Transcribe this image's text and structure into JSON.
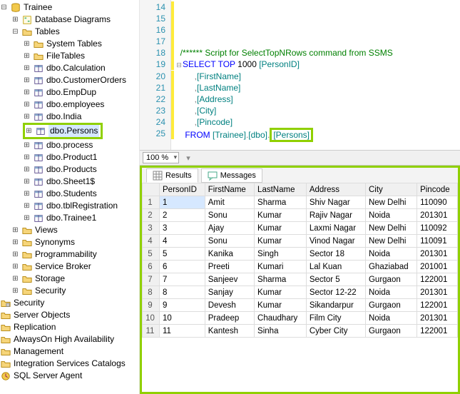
{
  "tree": {
    "trainee": "Trainee",
    "diagrams": "Database Diagrams",
    "tables": "Tables",
    "system_tables": "System Tables",
    "file_tables": "FileTables",
    "t_calc": "dbo.Calculation",
    "t_custorders": "dbo.CustomerOrders",
    "t_empdup": "dbo.EmpDup",
    "t_employees": "dbo.employees",
    "t_india": "dbo.India",
    "t_persons": "dbo.Persons",
    "t_process": "dbo.process",
    "t_product1": "dbo.Product1",
    "t_products": "dbo.Products",
    "t_sheet1": "dbo.Sheet1$",
    "t_students": "dbo.Students",
    "t_tblreg": "dbo.tblRegistration",
    "t_trainee1": "dbo.Trainee1",
    "views": "Views",
    "synonyms": "Synonyms",
    "programmability": "Programmability",
    "service_broker": "Service Broker",
    "storage": "Storage",
    "security": "Security",
    "root_security": "Security",
    "server_objects": "Server Objects",
    "replication": "Replication",
    "alwayson": "AlwaysOn High Availability",
    "management": "Management",
    "isc": "Integration Services Catalogs",
    "agent": "SQL Server Agent"
  },
  "editor": {
    "lines": {
      "l14": "14",
      "l15": "15",
      "l16": "16",
      "l17": "17",
      "l18": "18",
      "l19": "19",
      "l20": "20",
      "l21": "21",
      "l22": "22",
      "l23": "23",
      "l24": "24",
      "l25": "25"
    },
    "code": {
      "comment": "/****** Script for SelectTopNRows command from SSMS",
      "select": "SELECT",
      "top": "TOP",
      "topn": "1000",
      "personid": "[PersonID]",
      "comma": ",",
      "firstname": "[FirstName]",
      "lastname": "[LastName]",
      "address": "[Address]",
      "city": "[City]",
      "pincode": "[Pincode]",
      "from": "FROM",
      "bracket_trainee": "[Trainee]",
      "dot": ".",
      "bracket_dbo": "[dbo]",
      "persons": "[Persons]"
    },
    "zoom": "100 %"
  },
  "tabs": {
    "results": "Results",
    "messages": "Messages"
  },
  "grid": {
    "headers": [
      "PersonID",
      "FirstName",
      "LastName",
      "Address",
      "City",
      "Pincode"
    ],
    "rows": [
      [
        "1",
        "Amit",
        "Sharma",
        "Shiv Nagar",
        "New Delhi",
        "110090"
      ],
      [
        "2",
        "Sonu",
        "Kumar",
        "Rajiv Nagar",
        "Noida",
        "201301"
      ],
      [
        "3",
        "Ajay",
        "Kumar",
        "Laxmi Nagar",
        "New Delhi",
        "110092"
      ],
      [
        "4",
        "Sonu",
        "Kumar",
        "Vinod Nagar",
        "New Delhi",
        "110091"
      ],
      [
        "5",
        "Kanika",
        "Singh",
        "Sector 18",
        "Noida",
        "201301"
      ],
      [
        "6",
        "Preeti",
        "Kumari",
        "Lal Kuan",
        "Ghaziabad",
        "201001"
      ],
      [
        "7",
        "Sanjeev",
        "Sharma",
        "Sector 5",
        "Gurgaon",
        "122001"
      ],
      [
        "8",
        "Sanjay",
        "Kumar",
        "Sector 12-22",
        "Noida",
        "201301"
      ],
      [
        "9",
        "Devesh",
        "Kumar",
        "Sikandarpur",
        "Gurgaon",
        "122001"
      ],
      [
        "10",
        "Pradeep",
        "Chaudhary",
        "Film City",
        "Noida",
        "201301"
      ],
      [
        "11",
        "Kantesh",
        "Sinha",
        "Cyber City",
        "Gurgaon",
        "122001"
      ]
    ]
  }
}
